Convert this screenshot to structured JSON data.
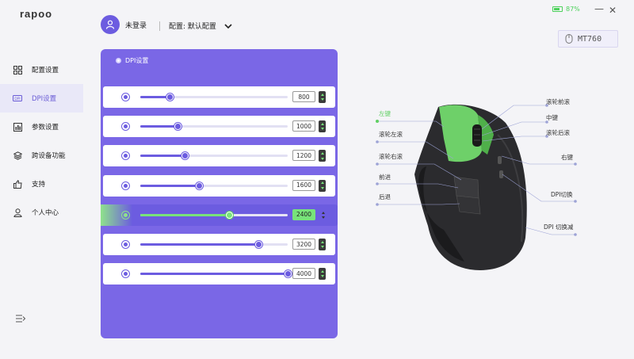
{
  "app": {
    "logo": "rapoo"
  },
  "sidebar": {
    "items": [
      {
        "label": "配置设置",
        "icon": "grid-icon",
        "active": false
      },
      {
        "label": "DPI设置",
        "icon": "dpi-icon",
        "active": true
      },
      {
        "label": "参数设置",
        "icon": "chart-icon",
        "active": false
      },
      {
        "label": "跨设备功能",
        "icon": "layers-icon",
        "active": false
      },
      {
        "label": "支持",
        "icon": "thumbs-up-icon",
        "active": false
      },
      {
        "label": "个人中心",
        "icon": "person-icon",
        "active": false
      }
    ],
    "collapse_icon": "menu-collapse-icon"
  },
  "header": {
    "user_name": "未登录",
    "profile_label": "配置: 默认配置",
    "battery": "87%",
    "device_name": "MT760"
  },
  "dpi": {
    "title": "DPI设置",
    "min": 0,
    "max": 4000,
    "levels": [
      {
        "value": "800",
        "fraction": 0.2,
        "active": false
      },
      {
        "value": "1000",
        "fraction": 0.25,
        "active": false
      },
      {
        "value": "1200",
        "fraction": 0.3,
        "active": false
      },
      {
        "value": "1600",
        "fraction": 0.4,
        "active": false
      },
      {
        "value": "2400",
        "fraction": 0.6,
        "active": true
      },
      {
        "value": "3200",
        "fraction": 0.8,
        "active": false
      },
      {
        "value": "4000",
        "fraction": 1.0,
        "active": false
      }
    ]
  },
  "mouse": {
    "labels": {
      "left_button": "左键",
      "scroll_left": "滚轮左滚",
      "scroll_right": "滚轮右滚",
      "forward": "前进",
      "back": "后退",
      "scroll_up": "滚轮前滚",
      "middle": "中键",
      "scroll_down": "滚轮后滚",
      "right_button": "右键",
      "dpi_switch": "DPI切换",
      "dpi_switch_down": "DPI 切换减"
    },
    "colors": {
      "accent": "#7a67e6",
      "highlight": "#5fcf62",
      "body": "#2b2b2e"
    }
  }
}
